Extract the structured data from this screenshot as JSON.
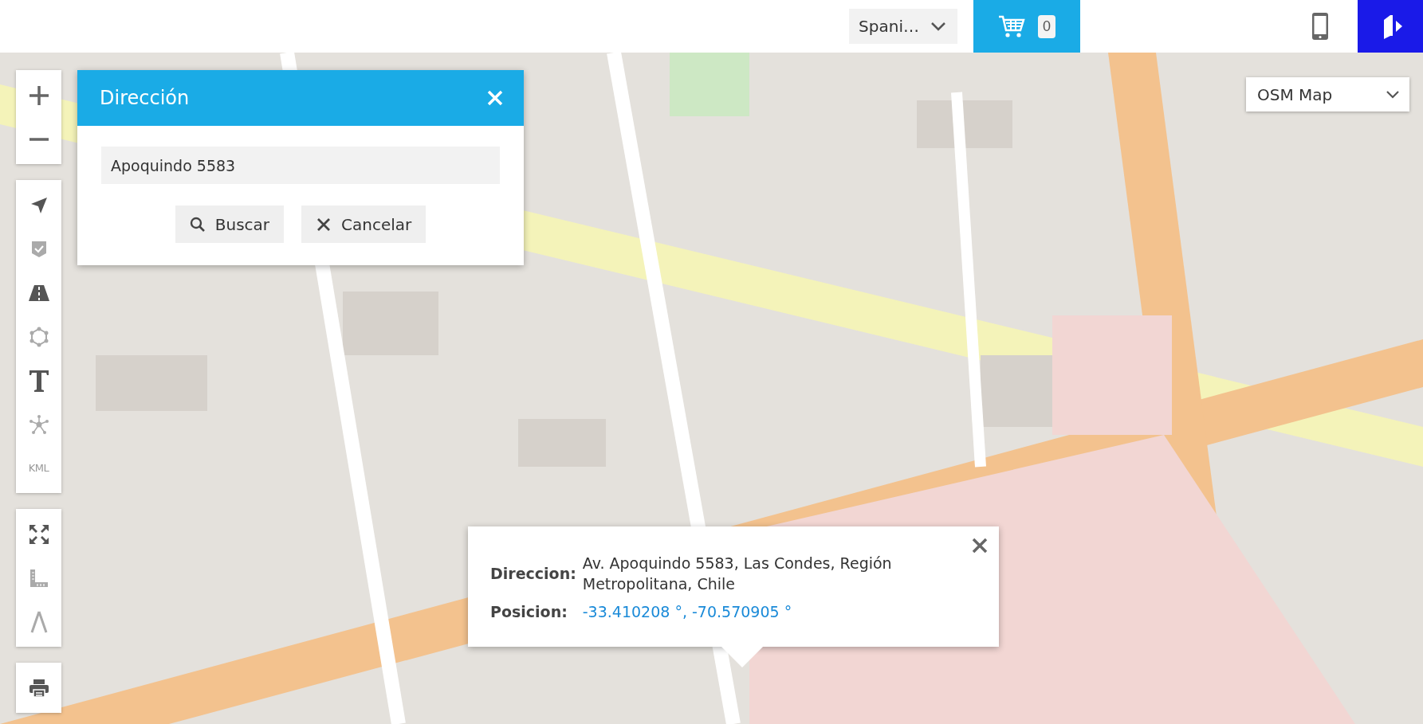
{
  "header": {
    "language": "Spani…",
    "cart_count": "0"
  },
  "map_layer": {
    "value": "OSM Map"
  },
  "toolbar": {
    "kml_label": "KML"
  },
  "address_dialog": {
    "title": "Dirección",
    "query": "Apoquindo 5583",
    "buttons": [
      {
        "label": "Buscar",
        "kind": "search"
      },
      {
        "label": "Cancelar",
        "kind": "cancel"
      }
    ]
  },
  "popup": {
    "rows": [
      {
        "label": "Direccion:",
        "value": "Av. Apoquindo 5583, Las Condes, Región Metropolitana, Chile",
        "kind": "text"
      },
      {
        "label": "Posicion:",
        "value": "-33.410208 °, -70.570905 °",
        "kind": "link"
      }
    ]
  }
}
